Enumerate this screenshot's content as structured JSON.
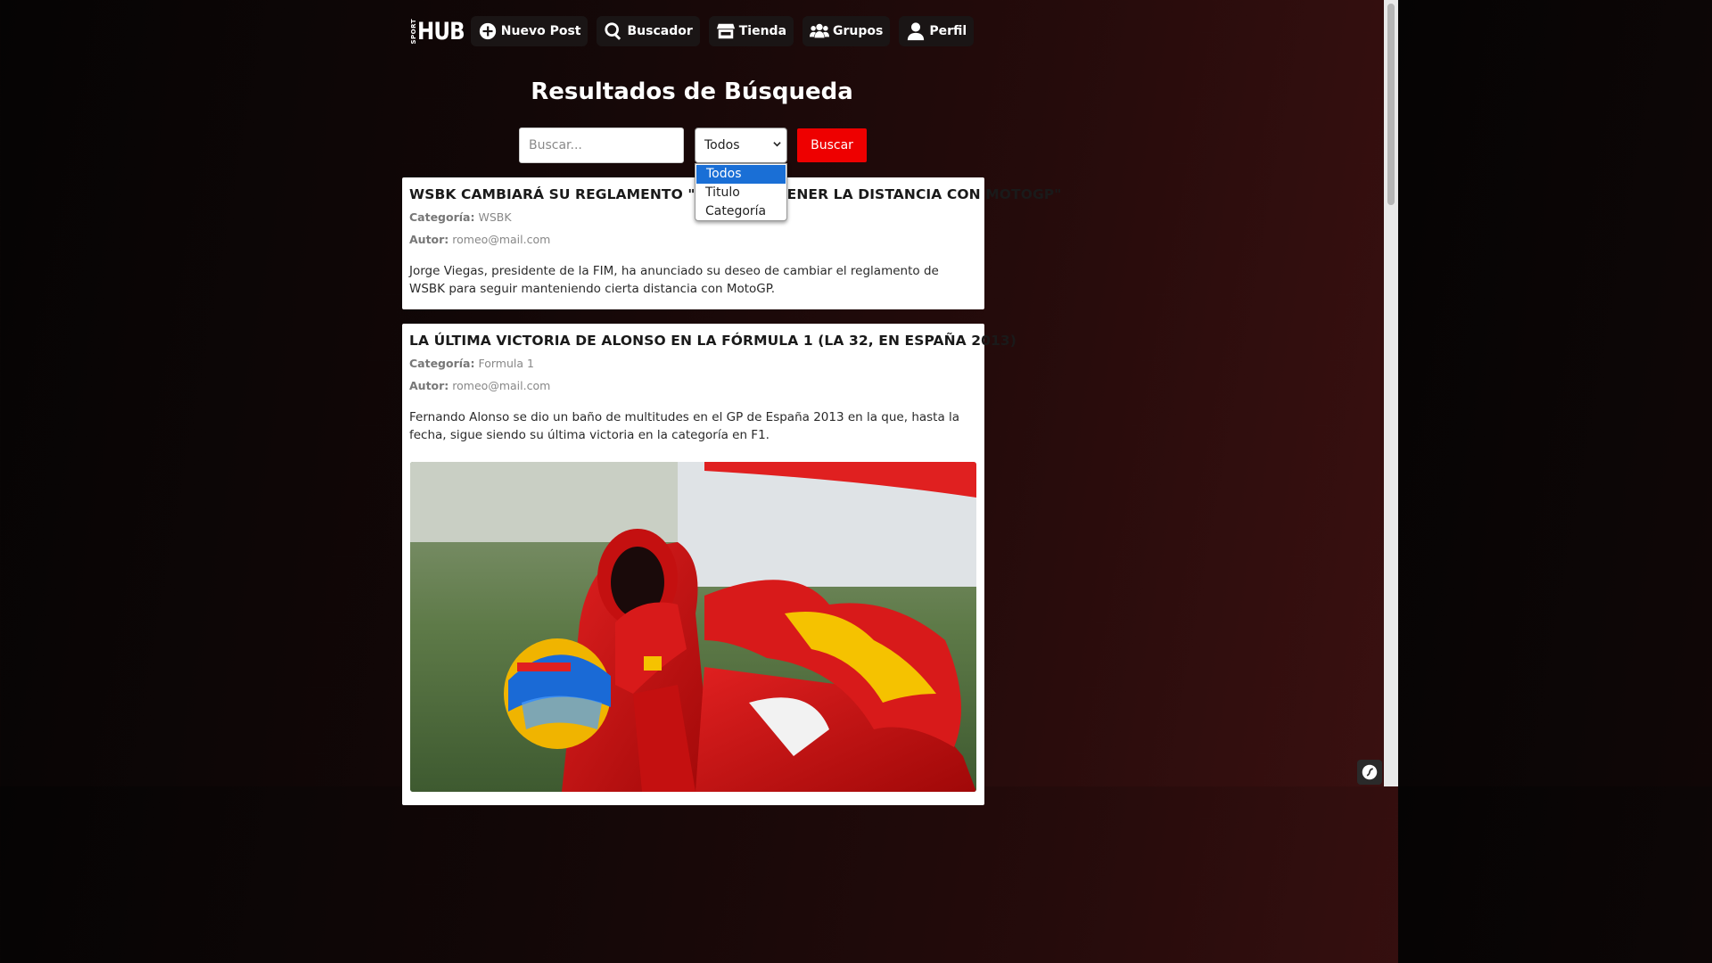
{
  "nav": {
    "logo_small": "SPORT",
    "logo_big": "HUB",
    "items": [
      {
        "label": "Nuevo Post",
        "icon": "plus-circle-icon"
      },
      {
        "label": "Buscador",
        "icon": "search-icon"
      },
      {
        "label": "Tienda",
        "icon": "store-icon"
      },
      {
        "label": "Grupos",
        "icon": "users-icon"
      },
      {
        "label": "Perfil",
        "icon": "user-icon"
      }
    ]
  },
  "page": {
    "title": "Resultados de Búsqueda"
  },
  "search": {
    "placeholder": "Buscar...",
    "value": "",
    "filter_selected": "Todos",
    "filter_options": [
      "Todos",
      "Titulo",
      "Categoría"
    ],
    "submit_label": "Buscar"
  },
  "posts": [
    {
      "title": "WSBK CAMBIARÁ SU REGLAMENTO \"PARA MANTENER LA DISTANCIA CON MOTOGP\"",
      "category_label": "Categoría:",
      "category": "WSBK",
      "author_label": "Autor:",
      "author": "romeo@mail.com",
      "body": "Jorge Viegas, presidente de la FIM, ha anunciado su deseo de cambiar el reglamento de WSBK para seguir manteniendo cierta distancia con MotoGP."
    },
    {
      "title": "LA ÚLTIMA VICTORIA DE ALONSO EN LA FÓRMULA 1 (LA 32, EN ESPAÑA 2013)",
      "category_label": "Categoría:",
      "category": "Formula 1",
      "author_label": "Autor:",
      "author": "romeo@mail.com",
      "body": "Fernando Alonso se dio un baño de multitudes en el GP de España 2013 en la que, hasta la fecha, sigue siendo su última victoria en la categoría en F1.",
      "image_alt": "Fernando Alonso celebrating with Spanish flag in Ferrari car"
    }
  ],
  "colors": {
    "accent": "#ee0000",
    "dropdown_highlight": "#1a6fd6"
  }
}
